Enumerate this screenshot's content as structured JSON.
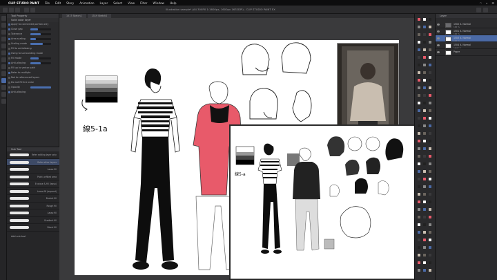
{
  "menubar": {
    "app_name": "CLIP STUDIO PAINT",
    "items": [
      "File",
      "Edit",
      "Story",
      "Animation",
      "Layer",
      "Select",
      "View",
      "Filter",
      "Window",
      "Help"
    ]
  },
  "command_bar": {
    "document_title": "Illustration sample* (A4 300PX 1:1600px, 1600px 1632DPI) - CLIP STUDIO PAINT EX"
  },
  "canvas_tabs": [
    "1517 Sketch1",
    "1519 Sketch2"
  ],
  "tool_property": {
    "header": "Tool Property",
    "subheader": "Solid color layer",
    "rows": [
      {
        "label": "Apply to connected portion only",
        "checked": true,
        "slider": null
      },
      {
        "label": "Close gap",
        "checked": true,
        "slider": 0.35
      },
      {
        "label": "Tolerance",
        "checked": false,
        "slider": 0.5
      },
      {
        "label": "Area scaling",
        "checked": true,
        "slider": 0.25
      },
      {
        "label": "Scaling mode",
        "checked": false,
        "slider": 0.6
      },
      {
        "label": "Fill to antialiasing",
        "checked": false,
        "slider": null
      },
      {
        "label": "Using to surrounding mode",
        "checked": true,
        "slider": null
      },
      {
        "label": "Fill mode",
        "checked": false,
        "slider": 0.4
      },
      {
        "label": "Anti-aliasing",
        "checked": true,
        "slider": 0.5
      },
      {
        "label": "Fill up to vector path",
        "checked": false,
        "slider": null
      },
      {
        "label": "Refer to multiple",
        "checked": true,
        "slider": null
      },
      {
        "label": "Not to referenced layers",
        "checked": false,
        "slider": null
      },
      {
        "label": "Do not fill line color",
        "checked": false,
        "slider": null
      },
      {
        "label": "Opacity",
        "checked": false,
        "slider": 1.0
      },
      {
        "label": "Anti-aliasing",
        "checked": true,
        "slider": null
      }
    ]
  },
  "sub_tool": {
    "header": "Sub Tool",
    "brushes": [
      {
        "label": "Refer editing layer only",
        "selected": false
      },
      {
        "label": "Refer other layers",
        "selected": true
      },
      {
        "label": "Lasso fill",
        "selected": false
      },
      {
        "label": "Paint unfilled area",
        "selected": false
      },
      {
        "label": "Enclose & fill (lasso)",
        "selected": false
      },
      {
        "label": "Lasso fill (expand)",
        "selected": false
      },
      {
        "label": "Bucket fill",
        "selected": false
      },
      {
        "label": "Rough fill",
        "selected": false
      },
      {
        "label": "Lasso fill",
        "selected": false
      },
      {
        "label": "Gradient fill",
        "selected": false
      },
      {
        "label": "Blend fill",
        "selected": false
      }
    ],
    "footer": "Add sub tool"
  },
  "canvas": {
    "label_main": "線5-1a",
    "label_inset": "線5-a"
  },
  "layers": {
    "header": "Layer",
    "rows": [
      {
        "name": "1502 X. Normal",
        "meta": "100 %",
        "selected": false,
        "folder": true
      },
      {
        "name": "1501 X. Normal",
        "meta": "100 %",
        "selected": false,
        "folder": false
      },
      {
        "name": "1503 X. Normal",
        "meta": "100 %",
        "selected": true,
        "folder": false
      },
      {
        "name": "1504 X. Normal",
        "meta": "Layer 2",
        "selected": false,
        "folder": false
      },
      {
        "name": "Paper",
        "meta": "",
        "selected": false,
        "folder": false
      }
    ]
  },
  "colors": {
    "accent": "#4b6aa6",
    "hoodie_red": "#e85a6a"
  }
}
